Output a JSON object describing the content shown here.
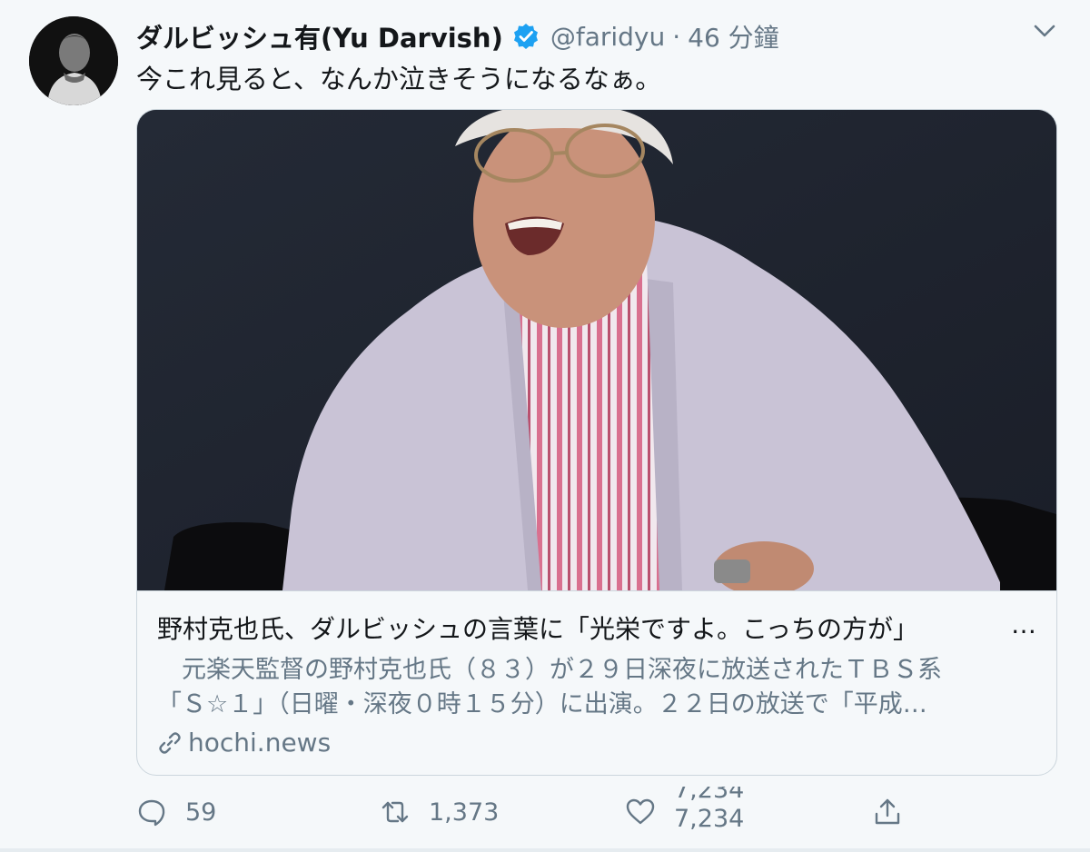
{
  "colors": {
    "background": "#f5f8fa",
    "text_primary": "#14171a",
    "text_secondary": "#657786",
    "verified_blue": "#1da1f2",
    "border": "#ccd6dd"
  },
  "tweet": {
    "author_name": "ダルビッシュ有(Yu Darvish)",
    "verified_icon": "verified-badge-icon",
    "handle": "@faridyu",
    "separator": "·",
    "time": "46 分鐘",
    "menu_icon": "chevron-down-icon",
    "text": "今これ見ると、なんか泣きそうになるなぁ。"
  },
  "card": {
    "image_alt": "man-in-jacket-photo",
    "title": "野村克也氏、ダルビッシュの言葉に「光栄ですよ。こっちの方が」",
    "title_ellipsis": "…",
    "description_line1": "　元楽天監督の野村克也氏（８３）が２９日深夜に放送されたＴＢＳ系",
    "description_line2": "「Ｓ☆１」（日曜・深夜０時１５分）に出演。２２日の放送で「平成…",
    "domain": "hochi.news",
    "domain_icon": "link-icon"
  },
  "actions": {
    "reply_icon": "reply-icon",
    "reply_count": "59",
    "retweet_icon": "retweet-icon",
    "retweet_count": "1,373",
    "like_icon": "heart-icon",
    "like_count_previous": "7,234",
    "like_count": "7,234",
    "share_icon": "share-icon"
  }
}
